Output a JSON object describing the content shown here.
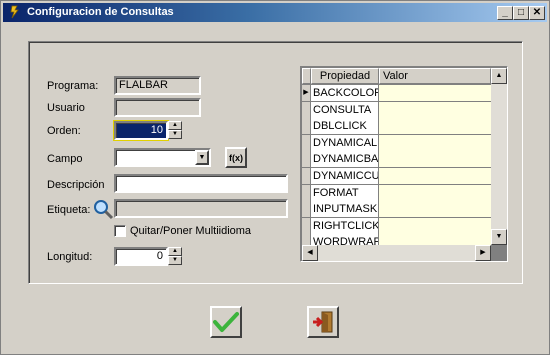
{
  "window": {
    "title": "Configuracion de Consultas",
    "min_label": "_",
    "max_label": "□",
    "close_label": "✕"
  },
  "form": {
    "programa_label": "Programa:",
    "programa_value": "FLALBAR",
    "usuario_label": "Usuario",
    "usuario_value": "",
    "orden_label": "Orden:",
    "orden_value": "10",
    "campo_label": "Campo",
    "campo_value": "",
    "fx_label": "f(x)",
    "descripcion_label": "Descripción",
    "descripcion_value": "",
    "etiqueta_label": "Etiqueta:",
    "etiqueta_value": "",
    "multiidioma_label": "Quitar/Poner Multiidioma",
    "multiidioma_checked": false,
    "longitud_label": "Longitud:",
    "longitud_value": "0"
  },
  "grid": {
    "headers": {
      "propiedad": "Propiedad",
      "valor": "Valor"
    },
    "rows": [
      {
        "prop": "BACKCOLOR",
        "value": "",
        "current": true
      },
      {
        "prop": "CONSULTA",
        "value": ""
      },
      {
        "prop": "DBLCLICK",
        "value": ""
      },
      {
        "prop": "DYNAMICALIG",
        "value": ""
      },
      {
        "prop": "DYNAMICBAC",
        "value": ""
      },
      {
        "prop": "DYNAMICCUR",
        "value": ""
      },
      {
        "prop": "FORMAT",
        "value": ""
      },
      {
        "prop": "INPUTMASK",
        "value": ""
      },
      {
        "prop": "RIGHTCLICK",
        "value": ""
      },
      {
        "prop": "WORDWRAP",
        "value": ""
      }
    ]
  },
  "colors": {
    "accept_green": "#3cb43c",
    "exit_red": "#c81e1e",
    "selected_field": "#0a246a",
    "grid_value_bg": "#ffffe1"
  }
}
